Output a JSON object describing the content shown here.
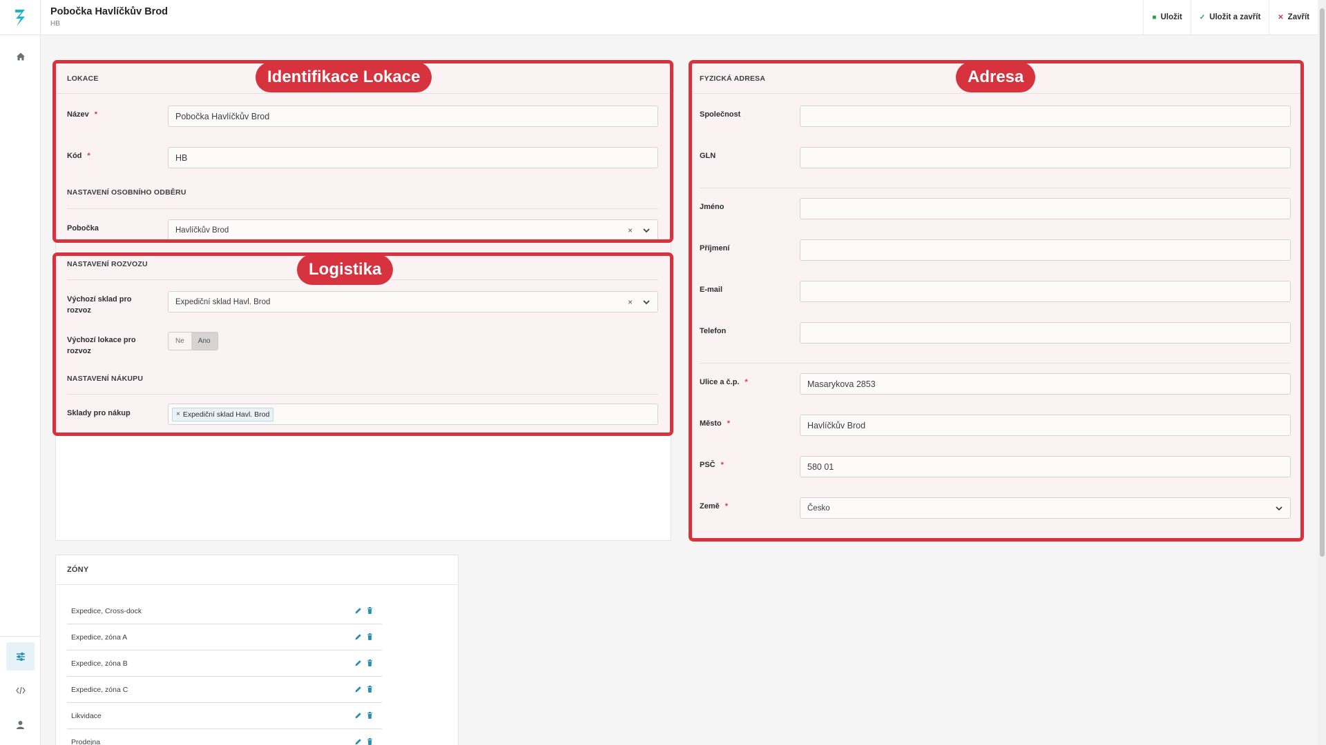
{
  "window": {
    "title": "Pobočka Havlíčkův Brod",
    "subtitle": "HB"
  },
  "toolbar": {
    "save_label": "Uložit",
    "save_close_label": "Uložit a zavřít",
    "close_label": "Zavřít"
  },
  "colors": {
    "accent": "#2b8fb3",
    "highlight": "#d6333f",
    "required": "#d7374b"
  },
  "sidebar": {
    "items": [
      {
        "icon": "home-icon"
      },
      {
        "icon": "sliders-icon",
        "active": true
      },
      {
        "icon": "code-icon"
      },
      {
        "icon": "user-icon"
      }
    ]
  },
  "annotations": {
    "identifikace": "Identifikace Lokace",
    "adresa": "Adresa",
    "logistika": "Logistika"
  },
  "lokace": {
    "heading": "LOKACE",
    "nazev_label": "Název",
    "nazev_value": "Pobočka Havlíčkův Brod",
    "kod_label": "Kód",
    "kod_value": "HB",
    "odber_heading": "NASTAVENÍ OSOBNÍHO ODBĚRU",
    "pobocka_label": "Pobočka",
    "pobocka_value": "Havlíčkův Brod"
  },
  "rozvoz": {
    "heading": "NASTAVENÍ ROZVOZU",
    "sklad_label": "Výchozí sklad pro rozvoz",
    "sklad_value": "Expediční sklad Havl. Brod",
    "lokace_label": "Výchozí lokace pro rozvoz",
    "toggle_no": "Ne",
    "toggle_yes": "Ano",
    "toggle_selected": "Ano",
    "nakup_heading": "NASTAVENÍ NÁKUPU",
    "sklady_label": "Sklady pro nákup",
    "sklady_chip": "Expediční sklad Havl. Brod",
    "chip_remove": "×"
  },
  "adresa": {
    "heading": "FYZICKÁ ADRESA",
    "spolecnost_label": "Společnost",
    "spolecnost_value": "",
    "gln_label": "GLN",
    "gln_value": "",
    "jmeno_label": "Jméno",
    "jmeno_value": "",
    "prijmeni_label": "Příjmení",
    "prijmeni_value": "",
    "email_label": "E-mail",
    "email_value": "",
    "telefon_label": "Telefon",
    "telefon_value": "",
    "ulice_label": "Ulice a č.p.",
    "ulice_value": "Masarykova 2853",
    "mesto_label": "Město",
    "mesto_value": "Havlíčkův Brod",
    "psc_label": "PSČ",
    "psc_value": "580 01",
    "zeme_label": "Země",
    "zeme_value": "Česko"
  },
  "required_mark": "*",
  "clear_mark": "×",
  "zony": {
    "heading": "ZÓNY",
    "rows": [
      "Expedice, Cross-dock",
      "Expedice, zóna A",
      "Expedice, zóna B",
      "Expedice, zóna C",
      "Likvidace",
      "Prodejna"
    ]
  }
}
